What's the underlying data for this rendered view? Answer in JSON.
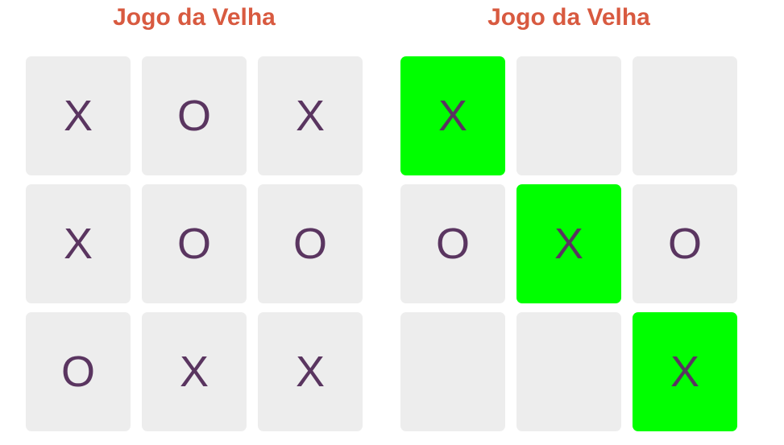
{
  "boards": [
    {
      "title": "Jogo da Velha",
      "cells": [
        "X",
        "O",
        "X",
        "X",
        "O",
        "O",
        "O",
        "X",
        "X"
      ],
      "highlighted": []
    },
    {
      "title": "Jogo da Velha",
      "cells": [
        "X",
        "",
        "",
        "O",
        "X",
        "O",
        "",
        "",
        "X"
      ],
      "highlighted": [
        0,
        4,
        8
      ]
    }
  ],
  "colors": {
    "title": "#d85a40",
    "mark": "#5a3560",
    "cell": "#ededed",
    "win": "#00ff00"
  }
}
